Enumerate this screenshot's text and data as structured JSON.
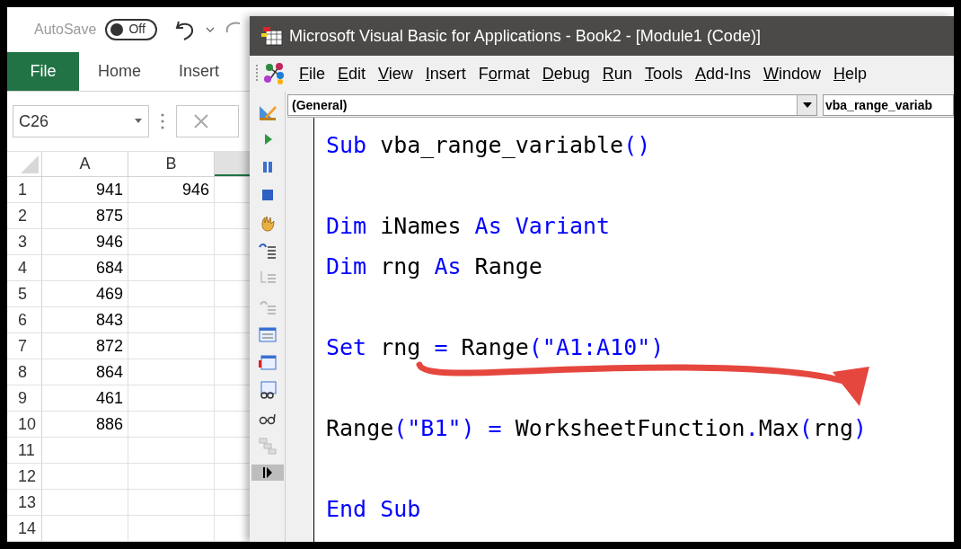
{
  "excel": {
    "autosave": {
      "label": "AutoSave",
      "on": false,
      "state_text": "Off"
    },
    "ribbon_tabs": [
      {
        "label": "File",
        "selected": true
      },
      {
        "label": "Home",
        "selected": false
      },
      {
        "label": "Insert",
        "selected": false
      }
    ],
    "name_box": "C26",
    "columns": [
      "A",
      "B"
    ],
    "rows": [
      {
        "header": "1",
        "cells": [
          "941",
          "946"
        ]
      },
      {
        "header": "2",
        "cells": [
          "875"
        ]
      },
      {
        "header": "3",
        "cells": [
          "946"
        ]
      },
      {
        "header": "4",
        "cells": [
          "684"
        ]
      },
      {
        "header": "5",
        "cells": [
          "469"
        ]
      },
      {
        "header": "6",
        "cells": [
          "843"
        ]
      },
      {
        "header": "7",
        "cells": [
          "872"
        ]
      },
      {
        "header": "8",
        "cells": [
          "864"
        ]
      },
      {
        "header": "9",
        "cells": [
          "461"
        ]
      },
      {
        "header": "10",
        "cells": [
          "886"
        ]
      },
      {
        "header": "11"
      },
      {
        "header": "12"
      },
      {
        "header": "13"
      },
      {
        "header": "14"
      }
    ]
  },
  "vba": {
    "title": "Microsoft Visual Basic for Applications - Book2 - [Module1 (Code)]",
    "menu": [
      {
        "key": "F",
        "post": "ile"
      },
      {
        "key": "E",
        "post": "dit"
      },
      {
        "key": "V",
        "post": "iew"
      },
      {
        "key": "I",
        "post": "nsert"
      },
      {
        "pre": "F",
        "key": "o",
        "post": "rmat"
      },
      {
        "key": "D",
        "post": "ebug"
      },
      {
        "key": "R",
        "post": "un"
      },
      {
        "key": "T",
        "post": "ools"
      },
      {
        "key": "A",
        "post": "dd-Ins"
      },
      {
        "key": "W",
        "post": "indow"
      },
      {
        "key": "H",
        "post": "elp"
      }
    ],
    "object_box": "(General)",
    "procedure_box": "vba_range_variab",
    "code_blocks": [
      [
        [
          {
            "text": "Sub",
            "kind": "keyword"
          },
          {
            "text": " vba_range_variable",
            "kind": "identifier"
          },
          {
            "text": "()",
            "kind": "keyword"
          }
        ]
      ],
      [
        [
          {
            "text": "Dim",
            "kind": "keyword"
          },
          {
            "text": " iNames ",
            "kind": "identifier"
          },
          {
            "text": "As Variant",
            "kind": "keyword"
          }
        ],
        [
          {
            "text": "Dim",
            "kind": "keyword"
          },
          {
            "text": " rng ",
            "kind": "identifier"
          },
          {
            "text": "As",
            "kind": "keyword"
          },
          {
            "text": " Range",
            "kind": "identifier"
          }
        ]
      ],
      [
        [
          {
            "text": "Set",
            "kind": "keyword"
          },
          {
            "text": " rng ",
            "kind": "identifier"
          },
          {
            "text": "=",
            "kind": "keyword"
          },
          {
            "text": " Range",
            "kind": "identifier"
          },
          {
            "text": "(\"A1:A10\")",
            "kind": "keyword"
          }
        ]
      ],
      [
        [
          {
            "text": "Range",
            "kind": "identifier"
          },
          {
            "text": "(\"B1\") =",
            "kind": "keyword"
          },
          {
            "text": " WorksheetFunction",
            "kind": "identifier"
          },
          {
            "text": ".",
            "kind": "keyword"
          },
          {
            "text": "Max",
            "kind": "identifier"
          },
          {
            "text": "(",
            "kind": "keyword"
          },
          {
            "text": "rng",
            "kind": "identifier"
          },
          {
            "text": ")",
            "kind": "keyword"
          }
        ]
      ],
      [
        [
          {
            "text": "End Sub",
            "kind": "keyword"
          }
        ]
      ]
    ]
  }
}
